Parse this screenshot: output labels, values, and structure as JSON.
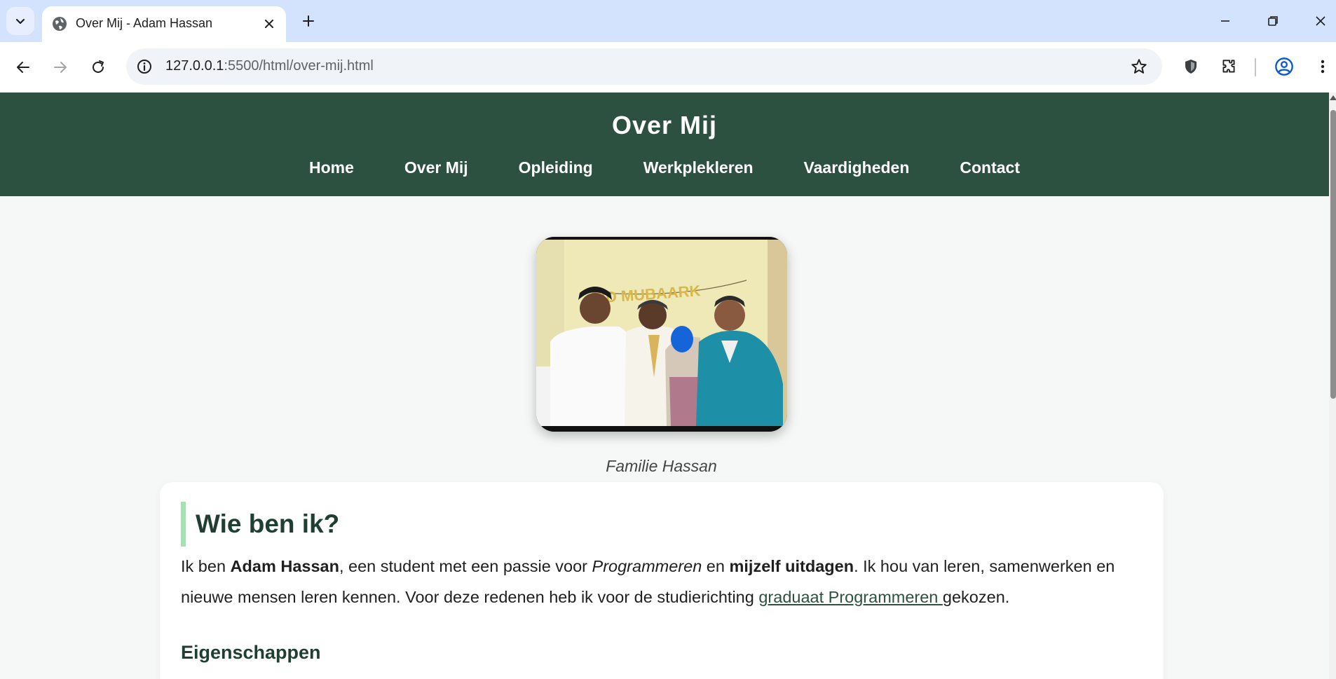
{
  "browser": {
    "tab_title": "Over Mij - Adam Hassan",
    "url_host": "127.0.0.1",
    "url_rest": ":5500/html/over-mij.html"
  },
  "site": {
    "title": "Over Mij",
    "nav": [
      "Home",
      "Over Mij",
      "Opleiding",
      "Werkplekleren",
      "Vaardigheden",
      "Contact"
    ]
  },
  "hero": {
    "banner_text": "EID MUBAARK",
    "caption": "Familie Hassan"
  },
  "about": {
    "heading": "Wie ben ik?",
    "p1": "Ik ben ",
    "name": "Adam Hassan",
    "p2": ", een student met een passie voor ",
    "passion": "Programmeren",
    "p3": " en ",
    "challenge": "mijzelf uitdagen",
    "p4": ". Ik hou van leren, samenwerken en nieuwe mensen leren kennen. Voor deze redenen heb ik voor de studierichting ",
    "link": "graduaat Programmeren ",
    "p5": "gekozen.",
    "subheading": "Eigenschappen"
  },
  "colors": {
    "header_bg": "#2d5141",
    "accent_bar": "#a8dfb4",
    "tabstrip_bg": "#d3e3fd"
  }
}
